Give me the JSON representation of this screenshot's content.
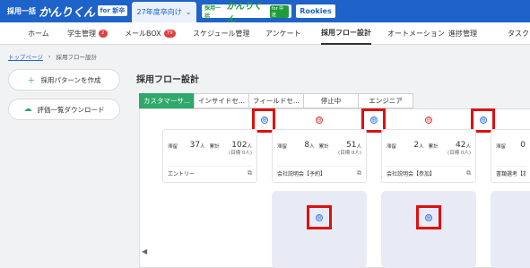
{
  "header": {
    "logo1": {
      "a": "採用一括",
      "b": "かんりくん",
      "tag": "for 新卒"
    },
    "year_tab": "27年度卒向け",
    "logo2": {
      "a": "採用一括",
      "b": "かんりくん",
      "tag": "for 中途"
    },
    "logo3": "Rookies"
  },
  "nav": {
    "items": [
      {
        "label": "ホーム"
      },
      {
        "label": "学生管理",
        "badge": "2"
      },
      {
        "label": "メールBOX",
        "badge": "79"
      },
      {
        "label": "スケジュール管理"
      },
      {
        "label": "アンケート"
      },
      {
        "label": "採用フロー設計",
        "active": true
      },
      {
        "label": "オートメーション"
      },
      {
        "label": "進捗管理"
      },
      {
        "label": "タスク"
      }
    ]
  },
  "breadcrumb": {
    "home": "トップページ",
    "sep": "›",
    "current": "採用フロー設計"
  },
  "sidebar": {
    "create_label": "採用パターンを作成",
    "download_label": "評価一覧ダウンロード"
  },
  "page_title": "採用フロー設計",
  "tabs": [
    "カスタマーサ...",
    "インサイドセ...",
    "フィールドセ...",
    "停止中",
    "エンジニア"
  ],
  "stages": [
    {
      "stay_label": "滞留",
      "stay": "37",
      "unit": "人",
      "total_label": "累計",
      "total": "102",
      "sub": "(目標 0人)",
      "name": "エントリー"
    },
    {
      "stay_label": "滞留",
      "stay": "8",
      "unit": "人",
      "total_label": "累計",
      "total": "51",
      "sub": "(目標 0人)",
      "name": "会社説明会【予約】"
    },
    {
      "stay_label": "滞留",
      "stay": "2",
      "unit": "人",
      "total_label": "累計",
      "total": "42",
      "sub": "(目標 0人)",
      "name": "会社説明会【参加】"
    },
    {
      "stay_label": "滞留",
      "stay": "0",
      "unit": "",
      "total_label": "",
      "total": "",
      "sub": "",
      "name": "書類選考【提出"
    }
  ],
  "icons": {
    "plus": "⊕",
    "minus": "⊖",
    "copy": "⧉",
    "chevron": "⌄",
    "left": "◀"
  },
  "colors": {
    "brand_blue": "#1d63c9",
    "accent_green": "#2fa86b",
    "highlight_red": "#e10e0e"
  }
}
